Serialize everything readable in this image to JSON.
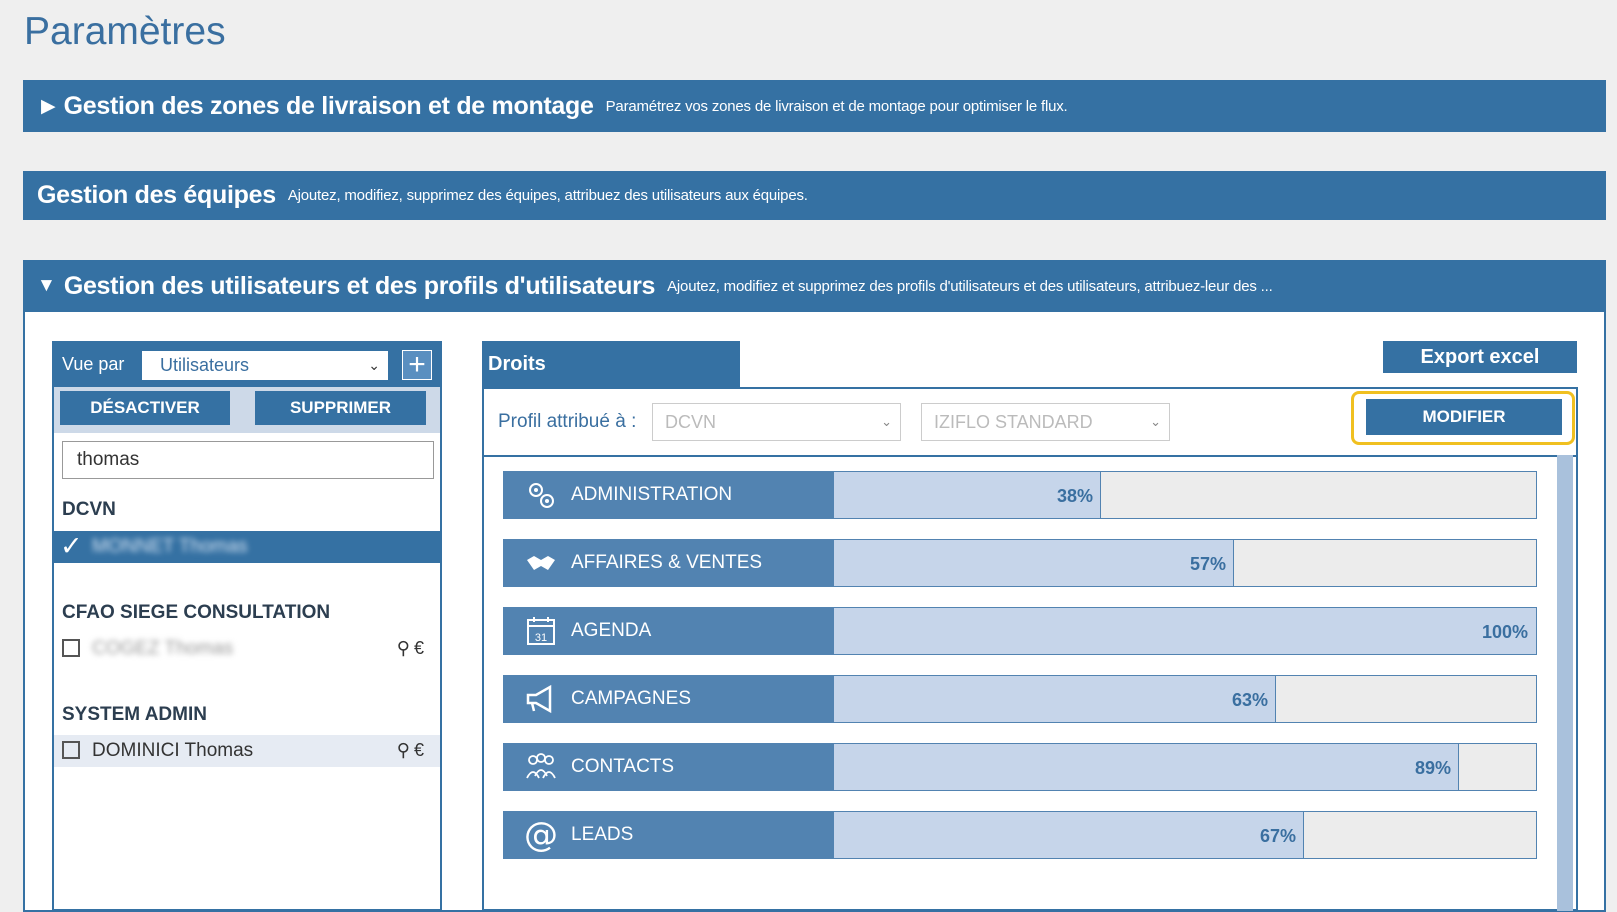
{
  "page": {
    "title": "Paramètres"
  },
  "sections": {
    "zones": {
      "arrow": "▶",
      "title": "Gestion des zones de livraison et de montage",
      "desc": "Paramétrez vos zones de livraison et de montage pour optimiser le flux."
    },
    "equipes": {
      "title": "Gestion des équipes",
      "desc": "Ajoutez, modifiez, supprimez des équipes, attribuez des utilisateurs aux équipes."
    },
    "utilisateurs": {
      "arrow": "▼",
      "title": "Gestion des utilisateurs et des profils d'utilisateurs",
      "desc": "Ajoutez, modifiez et supprimez des profils d'utilisateurs et des utilisateurs, attribuez-leur des ..."
    }
  },
  "left_panel": {
    "vue_label": "Vue par",
    "vue_select": "Utilisateurs",
    "add_label": "+",
    "deactivate": "DÉSACTIVER",
    "delete": "SUPPRIMER",
    "search_value": "thomas",
    "groups": [
      {
        "name": "DCVN",
        "users": [
          {
            "name": "MONNET Thomas",
            "selected": true
          }
        ]
      },
      {
        "name": "CFAO SIEGE CONSULTATION",
        "users": [
          {
            "name": "COGEZ Thomas",
            "selected": false
          }
        ]
      },
      {
        "name": "SYSTEM ADMIN",
        "users": [
          {
            "name": "DOMINICI Thomas",
            "selected": false
          }
        ]
      }
    ]
  },
  "right_panel": {
    "tab_label": "Droits",
    "export_label": "Export excel",
    "profil_label": "Profil attribué à :",
    "profil_value": "DCVN",
    "template_value": "IZIFLO STANDARD",
    "modifier_label": "MODIFIER",
    "permissions": [
      {
        "label": "ADMINISTRATION",
        "percent_label": "38%",
        "value": 38,
        "icon": "gears-icon"
      },
      {
        "label": "AFFAIRES & VENTES",
        "percent_label": "57%",
        "value": 57,
        "icon": "handshake-icon"
      },
      {
        "label": "AGENDA",
        "percent_label": "100%",
        "value": 100,
        "icon": "calendar-icon"
      },
      {
        "label": "CAMPAGNES",
        "percent_label": "63%",
        "value": 63,
        "icon": "megaphone-icon"
      },
      {
        "label": "CONTACTS",
        "percent_label": "89%",
        "value": 89,
        "icon": "people-icon"
      },
      {
        "label": "LEADS",
        "percent_label": "67%",
        "value": 67,
        "icon": "at-icon"
      }
    ]
  },
  "colors": {
    "primary": "#3571a3",
    "row_label": "#5283b1",
    "fill": "#c6d5ea",
    "highlight": "#f0c020"
  }
}
